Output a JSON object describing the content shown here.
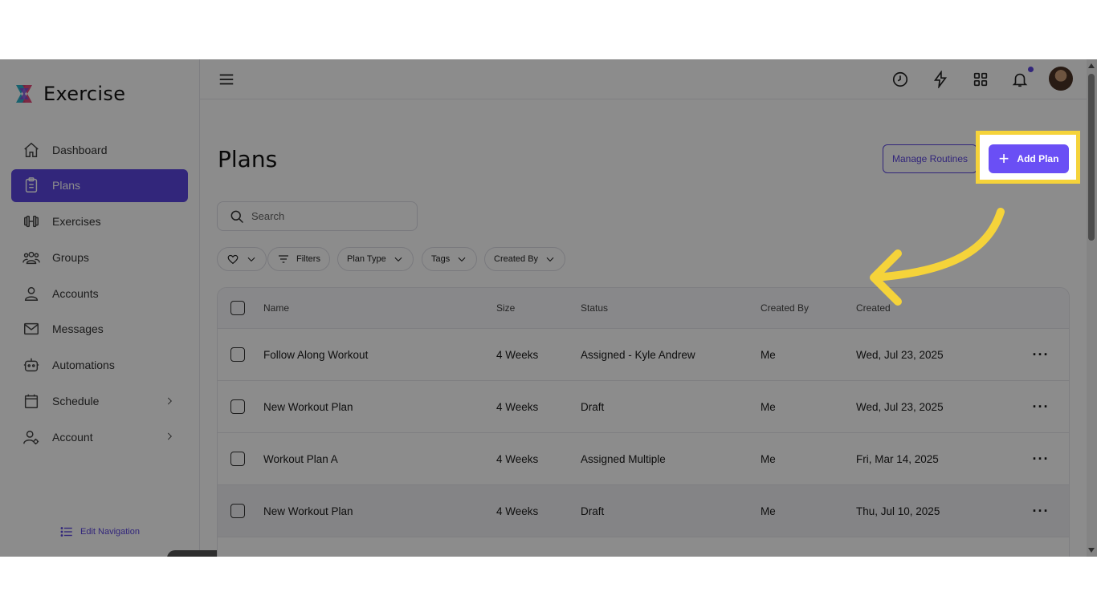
{
  "app": {
    "name": "Exercise"
  },
  "sidebar": {
    "items": [
      {
        "label": "Dashboard",
        "icon": "home-icon"
      },
      {
        "label": "Plans",
        "icon": "clipboard-icon",
        "active": true
      },
      {
        "label": "Exercises",
        "icon": "dumbbell-icon"
      },
      {
        "label": "Groups",
        "icon": "users-icon"
      },
      {
        "label": "Accounts",
        "icon": "user-icon"
      },
      {
        "label": "Messages",
        "icon": "mail-icon"
      },
      {
        "label": "Automations",
        "icon": "robot-icon"
      },
      {
        "label": "Schedule",
        "icon": "calendar-icon",
        "has_submenu": true
      },
      {
        "label": "Account",
        "icon": "user-gear-icon",
        "has_submenu": true
      }
    ],
    "edit_navigation": "Edit Navigation"
  },
  "topbar": {
    "icons": [
      "history-icon",
      "lightning-icon",
      "grid-icon",
      "bell-icon"
    ],
    "notification_dot": true
  },
  "main": {
    "title": "Plans",
    "manage_routines": "Manage Routines",
    "add_plan": "Add Plan",
    "search": {
      "placeholder": "Search",
      "value": ""
    },
    "filters": [
      "Filters",
      "Plan Type",
      "Tags",
      "Created By"
    ],
    "table": {
      "columns": [
        "Name",
        "Size",
        "Status",
        "Created By",
        "Created"
      ],
      "rows": [
        {
          "name": "Follow Along Workout",
          "size": "4 Weeks",
          "status": "Assigned - Kyle Andrew",
          "created_by": "Me",
          "created": "Wed, Jul 23, 2025"
        },
        {
          "name": "New Workout Plan",
          "size": "4 Weeks",
          "status": "Draft",
          "created_by": "Me",
          "created": "Wed, Jul 23, 2025"
        },
        {
          "name": "Workout Plan A",
          "size": "4 Weeks",
          "status": "Assigned Multiple",
          "created_by": "Me",
          "created": "Fri, Mar 14, 2025"
        },
        {
          "name": "New Workout Plan",
          "size": "4 Weeks",
          "status": "Draft",
          "created_by": "Me",
          "created": "Thu, Jul 10, 2025"
        }
      ]
    }
  },
  "colors": {
    "accent": "#5b45e0",
    "highlight": "#f5d33a"
  }
}
